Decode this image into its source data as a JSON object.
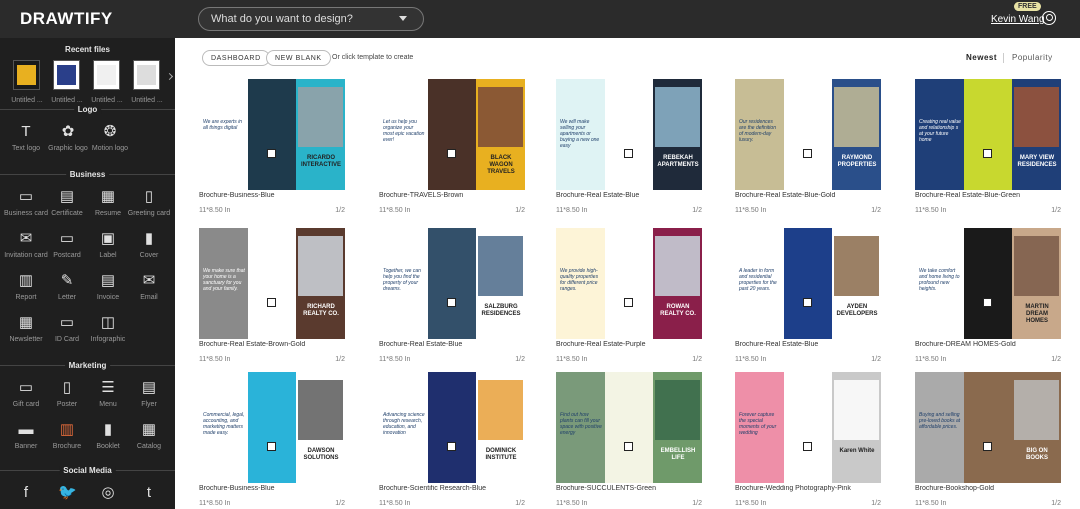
{
  "app": {
    "logo": "DRAWTIFY",
    "user_name": "Kevin Wang",
    "plan_badge": "FREE"
  },
  "search": {
    "placeholder": "What do you want to design?"
  },
  "sidebar": {
    "recent": {
      "title": "Recent files",
      "items": [
        {
          "label": "Untitled ..."
        },
        {
          "label": "Untitled ..."
        },
        {
          "label": "Untitled ..."
        },
        {
          "label": "Untitled ..."
        }
      ]
    },
    "sections": [
      {
        "title": "Logo",
        "items": [
          {
            "label": "Text logo",
            "icon": "text-logo-icon",
            "glyph": "T"
          },
          {
            "label": "Graphic logo",
            "icon": "graphic-logo-icon",
            "glyph": "✿"
          },
          {
            "label": "Motion logo",
            "icon": "motion-logo-icon",
            "glyph": "❂"
          }
        ]
      },
      {
        "title": "Business",
        "items": [
          {
            "label": "Business card",
            "icon": "business-card-icon",
            "glyph": "▭"
          },
          {
            "label": "Certificate",
            "icon": "certificate-icon",
            "glyph": "▤"
          },
          {
            "label": "Resume",
            "icon": "resume-icon",
            "glyph": "▦"
          },
          {
            "label": "Greeting card",
            "icon": "greeting-card-icon",
            "glyph": "▯"
          },
          {
            "label": "Invitation card",
            "icon": "invitation-card-icon",
            "glyph": "✉"
          },
          {
            "label": "Postcard",
            "icon": "postcard-icon",
            "glyph": "▭"
          },
          {
            "label": "Label",
            "icon": "label-icon",
            "glyph": "▣"
          },
          {
            "label": "Cover",
            "icon": "cover-icon",
            "glyph": "▮"
          },
          {
            "label": "Report",
            "icon": "report-icon",
            "glyph": "▥"
          },
          {
            "label": "Letter",
            "icon": "letter-icon",
            "glyph": "✎"
          },
          {
            "label": "Invoice",
            "icon": "invoice-icon",
            "glyph": "▤"
          },
          {
            "label": "Email",
            "icon": "email-icon",
            "glyph": "✉"
          },
          {
            "label": "Newsletter",
            "icon": "newsletter-icon",
            "glyph": "▦"
          },
          {
            "label": "ID Card",
            "icon": "id-card-icon",
            "glyph": "▭"
          },
          {
            "label": "Infographic",
            "icon": "infographic-icon",
            "glyph": "◫"
          }
        ]
      },
      {
        "title": "Marketing",
        "items": [
          {
            "label": "Gift card",
            "icon": "gift-card-icon",
            "glyph": "▭"
          },
          {
            "label": "Poster",
            "icon": "poster-icon",
            "glyph": "▯"
          },
          {
            "label": "Menu",
            "icon": "menu-icon",
            "glyph": "☰"
          },
          {
            "label": "Flyer",
            "icon": "flyer-icon",
            "glyph": "▤"
          },
          {
            "label": "Banner",
            "icon": "banner-icon",
            "glyph": "▬"
          },
          {
            "label": "Brochure",
            "icon": "brochure-icon",
            "glyph": "▥"
          },
          {
            "label": "Booklet",
            "icon": "booklet-icon",
            "glyph": "▮"
          },
          {
            "label": "Catalog",
            "icon": "catalog-icon",
            "glyph": "▦"
          }
        ]
      },
      {
        "title": "Social Media",
        "items": [
          {
            "label": "",
            "icon": "facebook-icon",
            "glyph": "f"
          },
          {
            "label": "",
            "icon": "twitter-icon",
            "glyph": "🐦"
          },
          {
            "label": "",
            "icon": "instagram-icon",
            "glyph": "◎"
          },
          {
            "label": "",
            "icon": "tumblr-icon",
            "glyph": "t"
          }
        ]
      }
    ]
  },
  "toolbar": {
    "dashboard_label": "DASHBOARD",
    "new_blank_label": "NEW BLANK",
    "hint": "Or click template to create",
    "sort_newest": "Newest",
    "sort_popularity": "Popularity"
  },
  "templates": [
    {
      "name": "Brochure-Business-Blue",
      "size": "11*8.50 In",
      "pages": "1/2",
      "colors": [
        "#ffffff",
        "#1e3a4c",
        "#2ab3c9",
        "#9aa0a6"
      ]
    },
    {
      "name": "Brochure-TRAVELS-Brown",
      "size": "11*8.50 In",
      "pages": "1/2",
      "colors": [
        "#ffffff",
        "#4a3128",
        "#e8b020",
        "#7a4a38"
      ]
    },
    {
      "name": "Brochure-Real Estate-Blue",
      "size": "11*8.50 In",
      "pages": "1/2",
      "colors": [
        "#dff3f4",
        "#ffffff",
        "#1f2a3a",
        "#8fb7cf"
      ]
    },
    {
      "name": "Brochure-Real Estate-Blue-Gold",
      "size": "11*8.50 In",
      "pages": "1/2",
      "colors": [
        "#c7bd95",
        "#ffffff",
        "#2a4f8a",
        "#c7bd95"
      ]
    },
    {
      "name": "Brochure-Real Estate-Blue-Green",
      "size": "11*8.50 In",
      "pages": "1/2",
      "colors": [
        "#1f3f78",
        "#c8d82f",
        "#1f3f78",
        "#a05535"
      ]
    },
    {
      "name": "Brochure-Real Estate-Brown-Gold",
      "size": "11*8.50 In",
      "pages": "1/2",
      "colors": [
        "#8a8a8a",
        "#ffffff",
        "#5a3a2e",
        "#d0d7de"
      ]
    },
    {
      "name": "Brochure-Real Estate-Blue",
      "size": "11*8.50 In",
      "pages": "1/2",
      "colors": [
        "#ffffff",
        "#33506a",
        "#ffffff",
        "#4a6888"
      ]
    },
    {
      "name": "Brochure-Real Estate-Purple",
      "size": "11*8.50 In",
      "pages": "1/2",
      "colors": [
        "#fdf4d7",
        "#ffffff",
        "#8a1f4a",
        "#c9d7de"
      ]
    },
    {
      "name": "Brochure-Real Estate-Blue",
      "size": "11*8.50 In",
      "pages": "1/2",
      "colors": [
        "#ffffff",
        "#1d3f8a",
        "#ffffff",
        "#8a6a4a"
      ]
    },
    {
      "name": "Brochure-DREAM HOMES-Gold",
      "size": "11*8.50 In",
      "pages": "1/2",
      "colors": [
        "#ffffff",
        "#1a1a1a",
        "#c8a88a",
        "#7a5a48"
      ]
    },
    {
      "name": "Brochure-Business-Blue",
      "size": "11*8.50 In",
      "pages": "1/2",
      "colors": [
        "#ffffff",
        "#2ab3d9",
        "#ffffff",
        "#5a5a5a"
      ]
    },
    {
      "name": "Brochure-Scientific Research-Blue",
      "size": "11*8.50 In",
      "pages": "1/2",
      "colors": [
        "#ffffff",
        "#1f2f6e",
        "#ffffff",
        "#e8a03a"
      ]
    },
    {
      "name": "Brochure-SUCCULENTS-Green",
      "size": "11*8.50 In",
      "pages": "1/2",
      "colors": [
        "#7a9a7a",
        "#f3f4e4",
        "#6f9a6a",
        "#3a6a4a"
      ]
    },
    {
      "name": "Brochure-Wedding Photography-Pink",
      "size": "11*8.50 In",
      "pages": "1/2",
      "colors": [
        "#ee8fa8",
        "#ffffff",
        "#c9c9c9",
        "#ffffff"
      ]
    },
    {
      "name": "Brochure-Bookshop-Gold",
      "size": "11*8.50 In",
      "pages": "1/2",
      "colors": [
        "#aaaaaa",
        "#8a6a4e",
        "#8a6a4e",
        "#bbbbbb"
      ]
    }
  ],
  "template_texts": [
    {
      "headline": "RICARDO INTERACTIVE",
      "sub": "We are experts in all things digital"
    },
    {
      "headline": "BLACK WAGON TRAVELS",
      "sub": "Let us help you organize your most epic vacation ever!"
    },
    {
      "headline": "REBEKAH APARTMENTS",
      "sub": "We will make selling your apartments or buying a new one easy"
    },
    {
      "headline": "RAYMOND PROPERTIES",
      "sub": "Our residences are the definition of modern-day luxury."
    },
    {
      "headline": "MARY VIEW RESIDENCES",
      "sub": "Creating real value and relationship s at your future home"
    },
    {
      "headline": "RICHARD REALTY CO.",
      "sub": "We make sure that your home is a sanctuary for you and your family."
    },
    {
      "headline": "SALZBURG RESIDENCES",
      "sub": "Together, we can help you find the property of your dreams."
    },
    {
      "headline": "ROWAN REALTY CO.",
      "sub": "We provide high-quality properties for different price ranges."
    },
    {
      "headline": "AYDEN DEVELOPERS",
      "sub": "A leader in form and residential properties for the past 20 years."
    },
    {
      "headline": "MARTIN DREAM HOMES",
      "sub": "We take comfort and home living to profound new heights."
    },
    {
      "headline": "DAWSON SOLUTIONS",
      "sub": "Commercial, legal, accounting, and marketing matters made easy."
    },
    {
      "headline": "DOMINICK INSTITUTE",
      "sub": "Advancing science through research, education, and innovation"
    },
    {
      "headline": "EMBELLISH LIFE",
      "sub": "Find out how plants can fill your space with positive energy"
    },
    {
      "headline": "Karen White",
      "sub": "Forever capture the special moments of your wedding"
    },
    {
      "headline": "BIG ON BOOKS",
      "sub": "Buying and selling pre-loved books at affordable prices."
    }
  ]
}
